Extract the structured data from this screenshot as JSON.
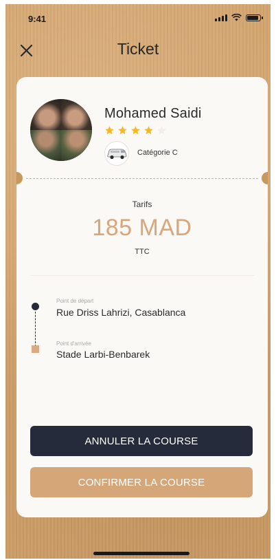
{
  "status_bar": {
    "time": "9:41"
  },
  "header": {
    "title": "Ticket",
    "close_icon": "close-icon"
  },
  "driver": {
    "name": "Mohamed Saidi",
    "rating": 4,
    "rating_max": 5,
    "vehicle_icon": "van-icon",
    "category": "Catégorie C"
  },
  "price": {
    "label": "Tarifs",
    "value": "185 MAD",
    "tax": "TTC"
  },
  "route": {
    "departure_caption": "Point de départ",
    "departure": "Rue Driss Lahrizi, Casablanca",
    "arrival_caption": "Point d'arrivée",
    "arrival": "Stade Larbi-Benbarek"
  },
  "actions": {
    "cancel_label": "ANNULER LA COURSE",
    "confirm_label": "CONFIRMER LA COURSE"
  },
  "colors": {
    "background": "#cfa06a",
    "card": "#fbf9f5",
    "accent": "#d5a778",
    "dark": "#262b3b",
    "star": "#f5b724"
  }
}
